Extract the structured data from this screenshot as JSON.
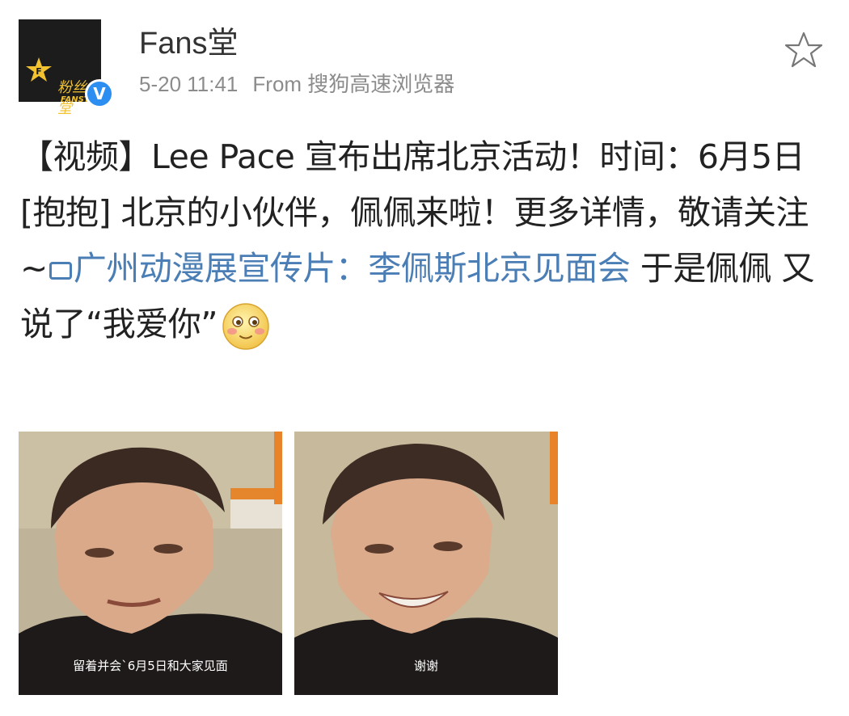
{
  "header": {
    "username": "Fans堂",
    "time": "5-20 11:41",
    "source": "From 搜狗高速浏览器",
    "avatar": {
      "logo_cn": "粉丝堂",
      "logo_en": "FANSTANG",
      "verified_mark": "V"
    }
  },
  "post": {
    "text_part1": "【视频】Lee Pace 宣布出席北京活动！时间：6月5日 [抱抱] 北京的小伙伴，佩佩来啦！更多详情，敬请关注~",
    "link_text": "广州动漫展宣传片：李佩斯北京见面会",
    "text_part2": " 于是佩佩 又说了“我爱你”"
  },
  "photos": [
    {
      "subtitle": "留着并会`6月5日和大家见面"
    },
    {
      "subtitle": "谢谢"
    }
  ],
  "icons": {
    "favorite": "star-outline-icon",
    "video": "video-icon",
    "emoji": "shy-smile-emoji",
    "verified": "verified-badge-icon"
  },
  "colors": {
    "link": "#4a7eb5",
    "verified": "#2c8ef0",
    "meta": "#8c8c8c"
  }
}
